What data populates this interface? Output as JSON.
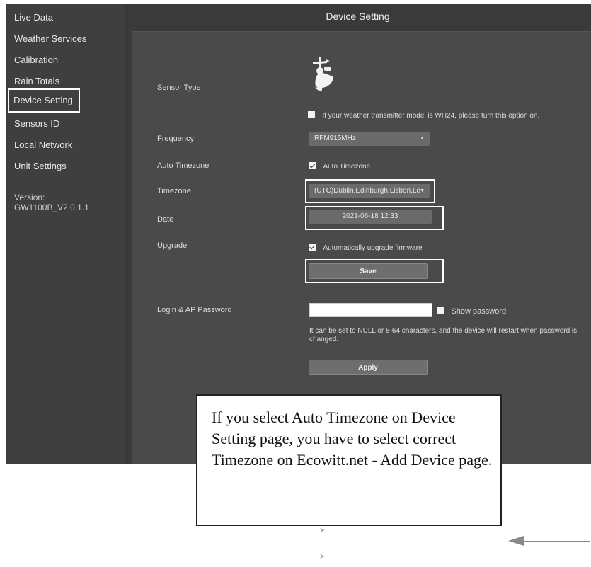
{
  "sidebar": {
    "items": [
      {
        "label": "Live Data"
      },
      {
        "label": "Weather Services"
      },
      {
        "label": "Calibration"
      },
      {
        "label": "Rain Totals"
      },
      {
        "label": "Device Setting"
      },
      {
        "label": "Sensors ID"
      },
      {
        "label": "Local Network"
      },
      {
        "label": "Unit Settings"
      }
    ],
    "version_label": "Version:",
    "version_value": "GW1100B_V2.0.1.1"
  },
  "header": {
    "title": "Device Setting"
  },
  "form": {
    "sensor_type_label": "Sensor Type",
    "wh24_option": "If your weather transmitter model is WH24, please turn this option on.",
    "frequency_label": "Frequency",
    "frequency_value": "RFM915MHz",
    "auto_timezone_label": "Auto Timezone",
    "auto_timezone_option": "Auto Timezone",
    "timezone_label": "Timezone",
    "timezone_value": "(UTC)Dublin,Edinburgh,Lisbon,Lo",
    "date_label": "Date",
    "date_value": "2021-06-18 12:33",
    "upgrade_label": "Upgrade",
    "upgrade_option": "Automatically upgrade firmware",
    "save_label": "Save",
    "password_label": "Login & AP Password",
    "password_value": "",
    "show_password_label": "Show password",
    "password_note": "It can be set to NULL or 8-64 characters, and the device will restart when password is changed.",
    "apply_label": "Apply"
  },
  "callout": {
    "text": "If you select Auto Timezone on Device Setting page, you have to select correct Timezone on Ecowitt.net - Add Device page."
  },
  "colors": {
    "sidebar_bg": "#3f3f3f",
    "panel_bg": "#4a4a4a",
    "accent": "#ffffff"
  }
}
